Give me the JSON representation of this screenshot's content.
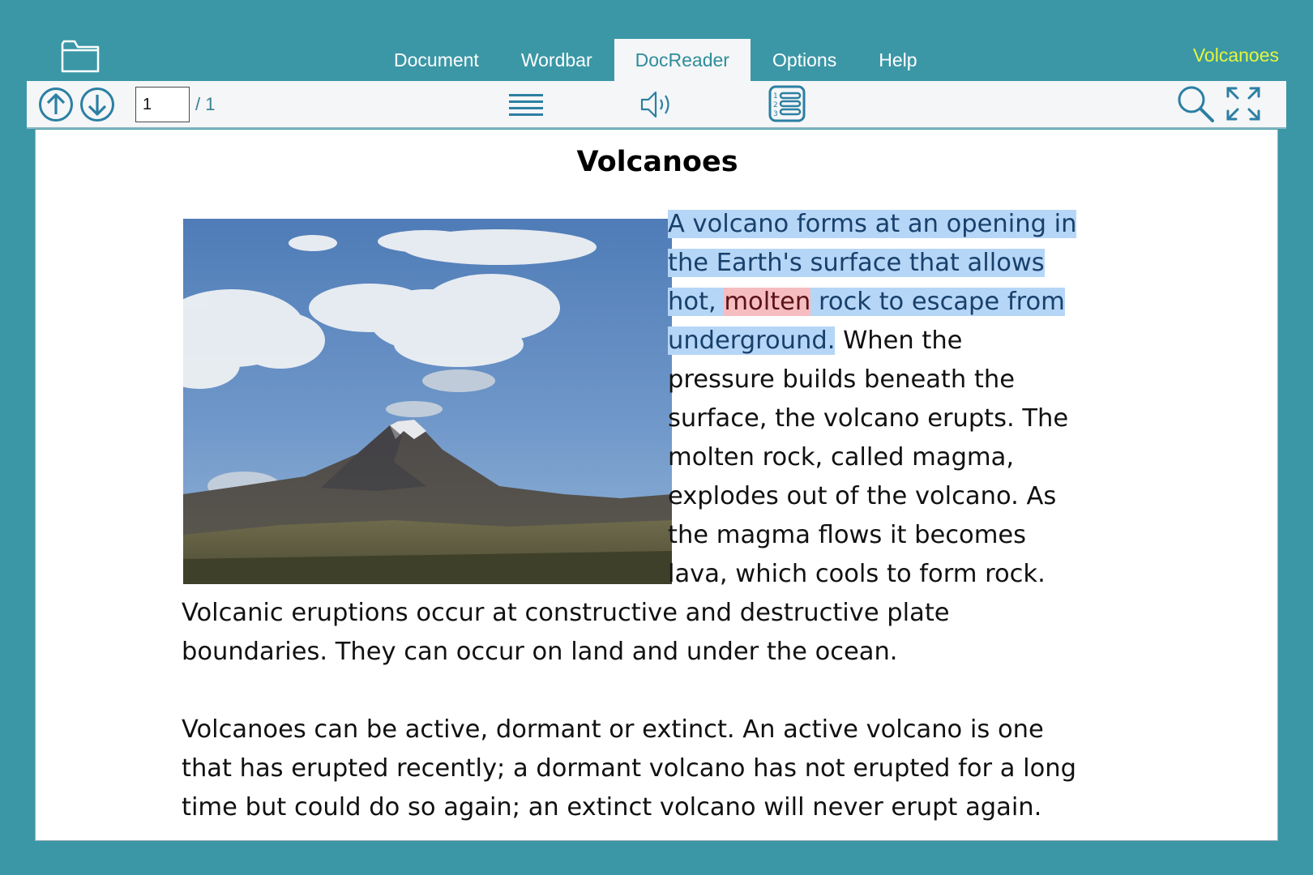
{
  "header": {
    "folder_icon": "folder-icon",
    "tabs": [
      {
        "label": "Document",
        "active": false
      },
      {
        "label": "Wordbar",
        "active": false
      },
      {
        "label": "DocReader",
        "active": true
      },
      {
        "label": "Options",
        "active": false
      },
      {
        "label": "Help",
        "active": false
      }
    ],
    "document_name": "Volcanoes"
  },
  "toolbar": {
    "page_current": "1",
    "page_total": "/ 1",
    "icons": [
      "arrow-up-circle-icon",
      "arrow-down-circle-icon",
      "lines-icon",
      "speaker-icon",
      "numbered-list-icon",
      "search-icon",
      "expand-icon"
    ]
  },
  "document": {
    "title": "Volcanoes",
    "image": "volcano-photo",
    "beside_image_lines": [
      {
        "parts": [
          {
            "t": "A volcano forms at an opening in",
            "hl": "sentence"
          }
        ]
      },
      {
        "parts": [
          {
            "t": "the Earth's surface that allows",
            "hl": "sentence"
          }
        ]
      },
      {
        "parts": [
          {
            "t": "hot, ",
            "hl": "sentence"
          },
          {
            "t": "molten",
            "hl": "word"
          },
          {
            "t": " rock to escape from",
            "hl": "sentence"
          }
        ]
      },
      {
        "parts": [
          {
            "t": "underground.",
            "hl": "sentence"
          },
          {
            "t": " When the",
            "hl": "none"
          }
        ]
      },
      {
        "parts": [
          {
            "t": "pressure builds beneath the",
            "hl": "none"
          }
        ]
      },
      {
        "parts": [
          {
            "t": "surface, the volcano erupts. The",
            "hl": "none"
          }
        ]
      },
      {
        "parts": [
          {
            "t": "molten rock, called magma,",
            "hl": "none"
          }
        ]
      },
      {
        "parts": [
          {
            "t": "explodes out of the volcano. As",
            "hl": "none"
          }
        ]
      },
      {
        "parts": [
          {
            "t": "the magma flows it becomes",
            "hl": "none"
          }
        ]
      },
      {
        "parts": [
          {
            "t": "lava, which cools to form rock.",
            "hl": "none"
          }
        ]
      }
    ],
    "full_lines": [
      "Volcanic eruptions occur at constructive and destructive plate",
      "boundaries. They can occur on land and under the ocean.",
      "",
      "Volcanoes can be active, dormant or extinct. An active volcano is one",
      "that has erupted recently; a dormant volcano has not erupted for a long",
      "time but could do so again; an extinct volcano will never erupt again."
    ],
    "highlight_colors": {
      "sentence": "#b6d6f7",
      "word": "#f6bdc1"
    }
  }
}
